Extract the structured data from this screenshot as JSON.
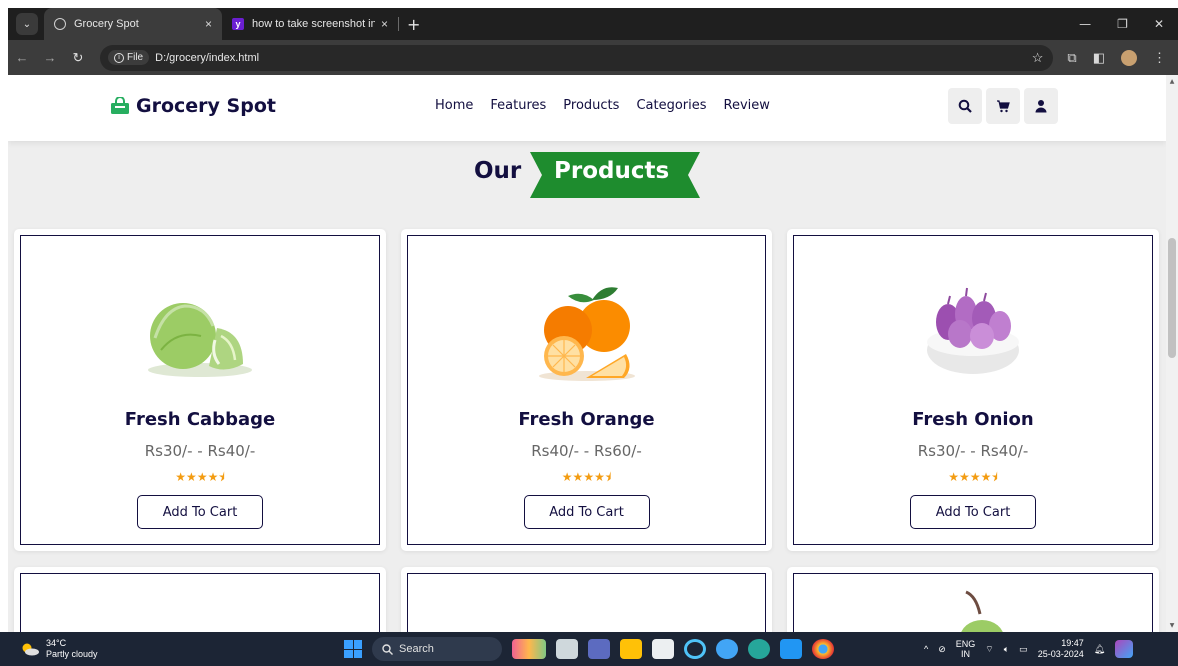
{
  "browser": {
    "tabs": [
      {
        "title": "Grocery Spot",
        "active": true
      },
      {
        "title": "how to take screenshot in lapto",
        "active": false
      }
    ],
    "new_tab": "+",
    "close_glyph": "×",
    "address": {
      "scheme_chip": "File",
      "url": "D:/grocery/index.html"
    }
  },
  "site": {
    "brand": "Grocery Spot",
    "brand_color": "#27ae60",
    "text_color": "#130f40",
    "nav": [
      "Home",
      "Features",
      "Products",
      "Categories",
      "Review"
    ],
    "header_icons": [
      "search-icon",
      "cart-icon",
      "user-icon"
    ]
  },
  "section": {
    "heading_plain": "Our",
    "heading_highlight": "Products",
    "ribbon_color": "#1e8c2e"
  },
  "products": [
    {
      "name": "Fresh Cabbage",
      "price": "Rs30/- - Rs40/-",
      "rating": 4.5,
      "button": "Add To Cart",
      "image": "cabbage"
    },
    {
      "name": "Fresh Orange",
      "price": "Rs40/- - Rs60/-",
      "rating": 4.5,
      "button": "Add To Cart",
      "image": "orange"
    },
    {
      "name": "Fresh Onion",
      "price": "Rs30/- - Rs40/-",
      "rating": 4.5,
      "button": "Add To Cart",
      "image": "onion"
    }
  ],
  "taskbar": {
    "weather": {
      "temp": "34°C",
      "condition": "Partly cloudy"
    },
    "search_label": "Search",
    "language": {
      "code": "ENG",
      "region": "IN"
    },
    "time": "19:47",
    "date": "25-03-2024"
  }
}
